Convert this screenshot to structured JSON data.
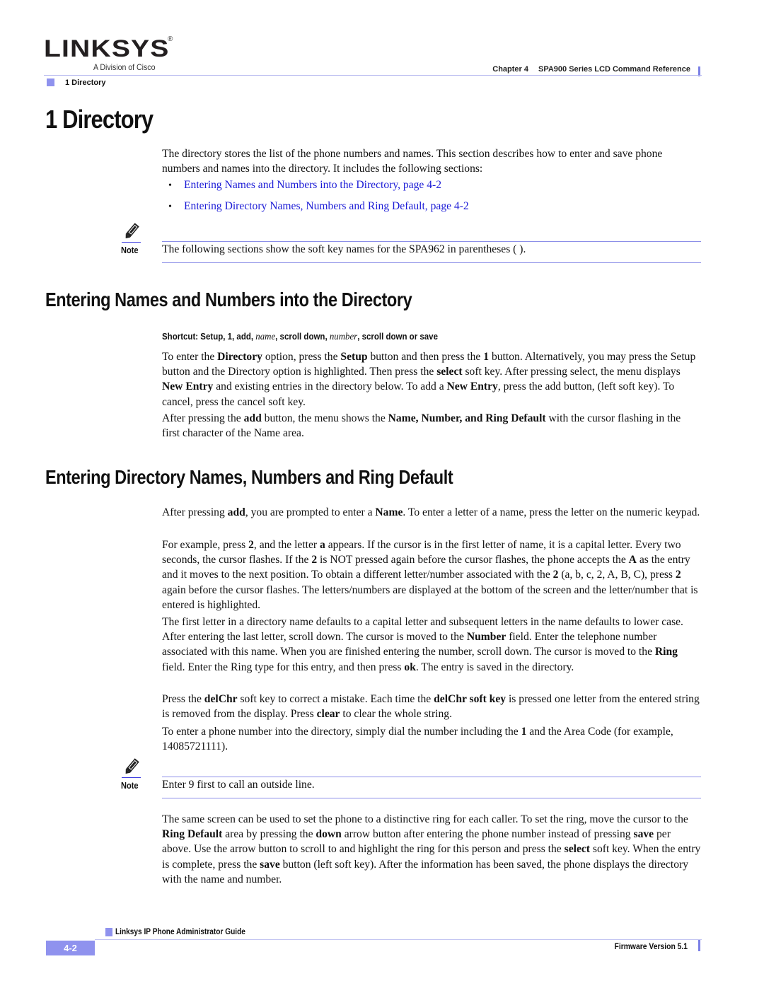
{
  "header": {
    "logo_text": "LINKSYS",
    "logo_registered": "®",
    "logo_tagline": "A Division of Cisco",
    "chapter": "Chapter 4",
    "chapter_title": "SPA900 Series LCD Command Reference",
    "breadcrumb": "1 Directory"
  },
  "page_title": "1 Directory",
  "intro": {
    "text": "The directory stores the list of the phone numbers and names. This section describes how to enter and save phone numbers and names into the directory. It includes the following sections:",
    "links": [
      {
        "label": "Entering Names and Numbers into the Directory, page 4-2"
      },
      {
        "label": "Entering Directory Names, Numbers and Ring Default, page 4-2"
      }
    ]
  },
  "notes": [
    {
      "label": "Note",
      "icon": "pencil-note-icon",
      "text": "The following sections show the soft key names for the SPA962 in parentheses ( )."
    },
    {
      "label": "Note",
      "icon": "pencil-note-icon",
      "text": "Enter 9 first to call an outside line."
    }
  ],
  "section1": {
    "heading": "Entering Names and Numbers into the Directory",
    "shortcut": {
      "prefix": "Shortcut: Setup, 1, add, ",
      "name_word": "name",
      "middle": ", scroll down, ",
      "number_word": "number",
      "suffix": ", scroll down or save"
    },
    "paragraphs": [
      [
        {
          "t": "To enter the "
        },
        {
          "b": "Directory"
        },
        {
          "t": " option, press the "
        },
        {
          "b": "Setup"
        },
        {
          "t": " button and then press the "
        },
        {
          "b": "1"
        },
        {
          "t": " button. Alternatively, you may press the Setup button and the Directory option is highlighted. Then press the "
        },
        {
          "b": "select"
        },
        {
          "t": " soft key. After pressing select, the menu displays "
        },
        {
          "b": "New Entry"
        },
        {
          "t": " and existing entries in the directory below. To add a "
        },
        {
          "b": "New Entry"
        },
        {
          "t": ", press the add button, (left soft key). To cancel, press the cancel soft key."
        }
      ],
      [
        {
          "t": "After pressing the "
        },
        {
          "b": "add"
        },
        {
          "t": " button, the menu shows the "
        },
        {
          "b": "Name, Number, and Ring Default"
        },
        {
          "t": " with the cursor flashing in the first character of the Name area."
        }
      ]
    ]
  },
  "section2": {
    "heading": "Entering Directory Names, Numbers and Ring Default",
    "paragraphs": [
      [
        {
          "t": "After pressing "
        },
        {
          "b": "add"
        },
        {
          "t": ", you are prompted to enter a "
        },
        {
          "b": "Name"
        },
        {
          "t": ". To enter a letter of a name, press the letter on the numeric keypad."
        }
      ],
      [
        {
          "t": "For example, press "
        },
        {
          "b": "2"
        },
        {
          "t": ", and the letter "
        },
        {
          "b": "a"
        },
        {
          "t": " appears. If the cursor is in the first letter of name, it is a capital letter. Every two seconds, the cursor flashes. If the "
        },
        {
          "b": "2"
        },
        {
          "t": " is NOT pressed again before the cursor flashes, the phone accepts the "
        },
        {
          "b": "A"
        },
        {
          "t": " as the entry and it moves to the next position. To obtain a different letter/number associated with the "
        },
        {
          "b": "2"
        },
        {
          "t": " (a, b, c, 2, A, B, C), press "
        },
        {
          "b": "2"
        },
        {
          "t": " again before the cursor flashes. The letters/numbers are displayed at the bottom of the screen and the letter/number that is entered is highlighted."
        }
      ],
      [
        {
          "t": "The first letter in a directory name defaults to a capital letter and subsequent letters in the name defaults to lower case. After entering the last letter, scroll down. The cursor is moved to the "
        },
        {
          "b": "Number"
        },
        {
          "t": " field. Enter the telephone number associated with this name. When you are finished entering the number, scroll down. The cursor is moved to the "
        },
        {
          "b": "Ring"
        },
        {
          "t": " field. Enter the Ring type for this entry, and then press "
        },
        {
          "b": "ok"
        },
        {
          "t": ". The entry is saved in the directory."
        }
      ],
      [
        {
          "t": "Press the "
        },
        {
          "b": "delChr"
        },
        {
          "t": " soft key to correct a mistake. Each time the "
        },
        {
          "b": "delChr soft key"
        },
        {
          "t": " is pressed one letter from the entered string is removed from the display. Press "
        },
        {
          "b": "clear"
        },
        {
          "t": " to clear the whole string."
        }
      ],
      [
        {
          "t": "To enter a phone number into the directory, simply dial the number including the "
        },
        {
          "b": "1"
        },
        {
          "t": " and the Area Code (for example, 14085721111)."
        }
      ]
    ],
    "closing": [
      {
        "t": "The same screen can be used to set the phone to a distinctive ring for each caller. To set the ring, move the cursor to the "
      },
      {
        "b": "Ring Default"
      },
      {
        "t": " area by pressing the "
      },
      {
        "b": "down"
      },
      {
        "t": " arrow button after entering the phone number instead of pressing "
      },
      {
        "b": "save"
      },
      {
        "t": " per above. Use the arrow button to scroll to and highlight the ring for this person and press the "
      },
      {
        "b": "select"
      },
      {
        "t": " soft key. When the entry is complete, press the "
      },
      {
        "b": "save"
      },
      {
        "t": " button (left soft key). After the information has been saved, the phone displays the directory with the name and number."
      }
    ]
  },
  "footer": {
    "guide_title": "Linksys IP Phone Administrator Guide",
    "page_number": "4-2",
    "firmware": "Firmware Version 5.1"
  },
  "colors": {
    "accent": "#8f92ee",
    "link": "#1b1bd6",
    "rule": "#8c8fe8"
  }
}
